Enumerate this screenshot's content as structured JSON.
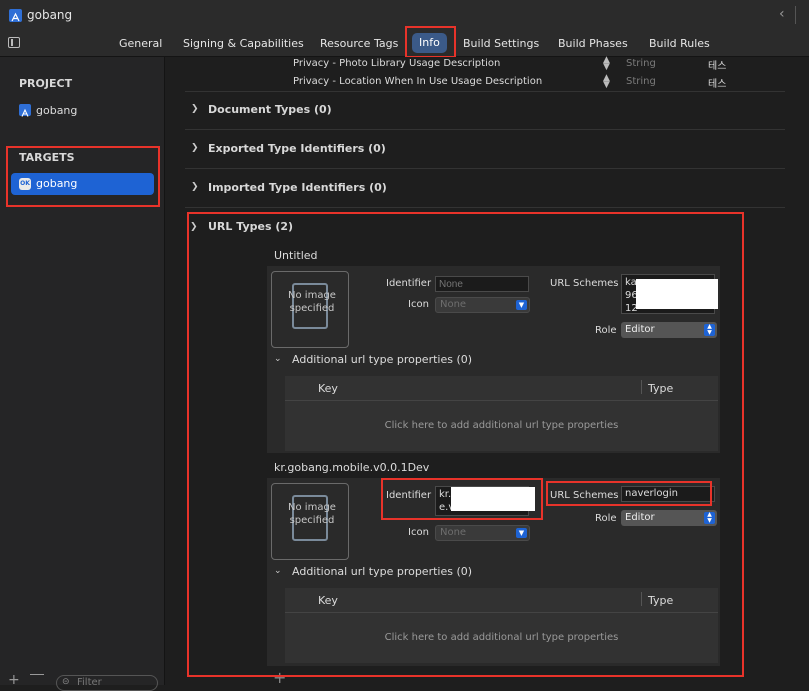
{
  "window": {
    "title": "gobang"
  },
  "tabs": [
    {
      "label": "General"
    },
    {
      "label": "Signing & Capabilities"
    },
    {
      "label": "Resource Tags"
    },
    {
      "label": "Info"
    },
    {
      "label": "Build Settings"
    },
    {
      "label": "Build Phases"
    },
    {
      "label": "Build Rules"
    }
  ],
  "sidebar": {
    "project_header": "PROJECT",
    "project_item": "gobang",
    "targets_header": "TARGETS",
    "target_item": "gobang",
    "filter_placeholder": "Filter"
  },
  "privacy_rows": [
    {
      "key": "Privacy - Photo Library Usage Description",
      "type": "String",
      "value": "테스"
    },
    {
      "key": "Privacy - Location When In Use Usage Description",
      "type": "String",
      "value": "테스"
    }
  ],
  "sections": {
    "document_types": "Document Types (0)",
    "exported_types": "Exported Type Identifiers (0)",
    "imported_types": "Imported Type Identifiers (0)",
    "url_types": "URL Types (2)"
  },
  "labels": {
    "identifier": "Identifier",
    "icon": "Icon",
    "url_schemes": "URL Schemes",
    "role": "Role",
    "additional": "Additional url type properties (0)",
    "key_col": "Key",
    "type_col": "Type",
    "add_hint": "Click here to add additional url type properties",
    "no_image": "No image specified"
  },
  "url_types": [
    {
      "name": "Untitled",
      "identifier_placeholder": "None",
      "icon_value": "None",
      "url_schemes_lines": [
        "ka",
        "96",
        "12"
      ],
      "role": "Editor"
    },
    {
      "name": "kr.gobang.mobile.v0.0.1Dev",
      "identifier_lines": [
        "kr.",
        "e.v"
      ],
      "icon_value": "None",
      "url_schemes_value": "naverlogin",
      "role": "Editor"
    }
  ],
  "bottom": {
    "add_symbol": "+"
  }
}
